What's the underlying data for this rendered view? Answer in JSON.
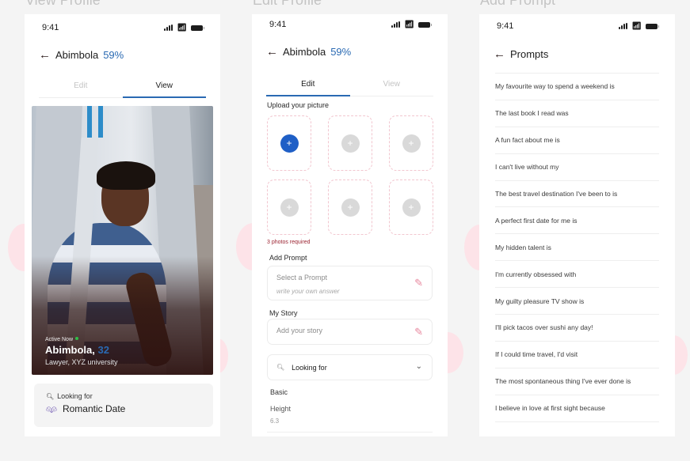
{
  "frames": [
    {
      "title": "View Profile"
    },
    {
      "title": "Edit Profile"
    },
    {
      "title": "Add Prompt"
    }
  ],
  "status_bar": {
    "time": "9:41"
  },
  "profile": {
    "name": "Abimbola",
    "completion": "59%",
    "tabs": [
      {
        "label": "Edit"
      },
      {
        "label": "View"
      }
    ]
  },
  "view_profile": {
    "active_tab": "View",
    "status": "Active Now",
    "display_name": "Abimbola,",
    "age": "32",
    "occupation": "Lawyer, XYZ university",
    "looking_for_label": "Looking for",
    "looking_for_value": "Romantic Date"
  },
  "edit_profile": {
    "active_tab": "Edit",
    "upload_label": "Upload your picture",
    "photo_slots": 6,
    "photos_required": "3 photos required",
    "add_prompt_label": "Add Prompt",
    "prompt_placeholder": "Select a Prompt",
    "answer_placeholder": "write your own answer",
    "story_label": "My Story",
    "story_placeholder": "Add your story",
    "looking_for_placeholder": "Looking for",
    "basic_label": "Basic",
    "height_label": "Height",
    "height_value": "6.3"
  },
  "add_prompt": {
    "title": "Prompts",
    "prompts": [
      "My favourite way to spend a weekend is",
      "The last book I read was",
      "A fun fact about me is",
      "I can't live without my",
      "The best travel destination I've been to is",
      "A perfect first date for me is",
      "My hidden talent is",
      "I'm currently obsessed with",
      "My guilty pleasure TV show is",
      "I'll pick tacos over sushi any day!",
      "If I could time travel, I'd visit",
      "The most spontaneous thing I've ever done is",
      "I believe in love at first sight because"
    ]
  },
  "colors": {
    "accent_blue": "#2a6ab3",
    "upload_primary": "#1f5fc6",
    "warning_red": "#9b2331",
    "edit_pink": "#e88aa0",
    "online_green": "#2fbf48"
  }
}
